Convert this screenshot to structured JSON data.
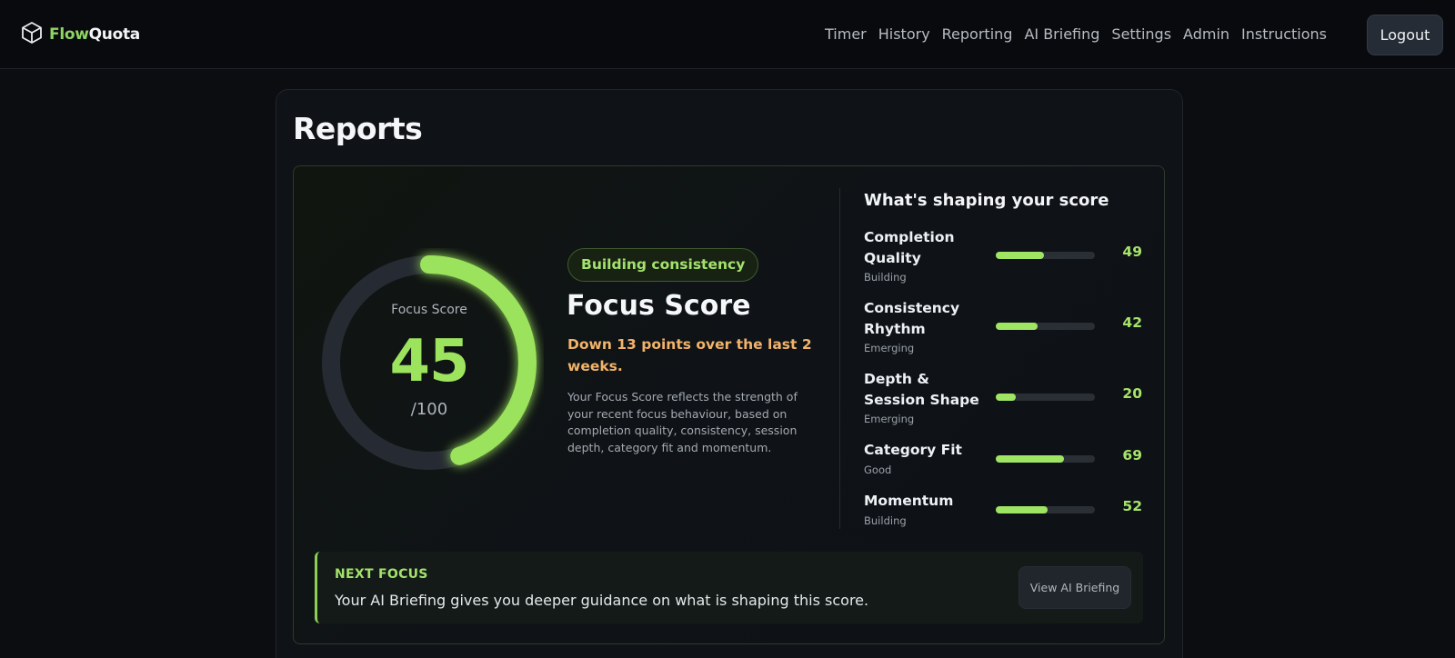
{
  "brand": {
    "part1": "Flow",
    "part2": "Quota",
    "logo_icon": "cube-icon"
  },
  "nav": {
    "links": [
      "Timer",
      "History",
      "Reporting",
      "AI Briefing",
      "Settings",
      "Admin",
      "Instructions"
    ],
    "logout_label": "Logout"
  },
  "page": {
    "title": "Reports"
  },
  "score": {
    "ring_caption": "Focus Score",
    "value": "45",
    "max_label": "/100",
    "ring_fraction": 0.45,
    "badge": "Building consistency",
    "title": "Focus Score",
    "delta": "Down 13 points over the last 2 weeks.",
    "description": "Your Focus Score reflects the strength of your recent focus behaviour, based on completion quality, consistency, session depth, category fit and momentum."
  },
  "shaping": {
    "title": "What's shaping your score",
    "metrics": [
      {
        "name": "Completion Quality",
        "status": "Building",
        "value": 49
      },
      {
        "name": "Consistency Rhythm",
        "status": "Emerging",
        "value": 42
      },
      {
        "name": "Depth & Session Shape",
        "status": "Emerging",
        "value": 20
      },
      {
        "name": "Category Fit",
        "status": "Good",
        "value": 69
      },
      {
        "name": "Momentum",
        "status": "Building",
        "value": 52
      }
    ]
  },
  "next_focus": {
    "label": "NEXT FOCUS",
    "text": "Your AI Briefing gives you deeper guidance on what is shaping this score.",
    "button_label": "View AI Briefing"
  },
  "colors": {
    "accent": "#9ce35e",
    "warning": "#f2b36a",
    "background": "#0b0d10"
  }
}
